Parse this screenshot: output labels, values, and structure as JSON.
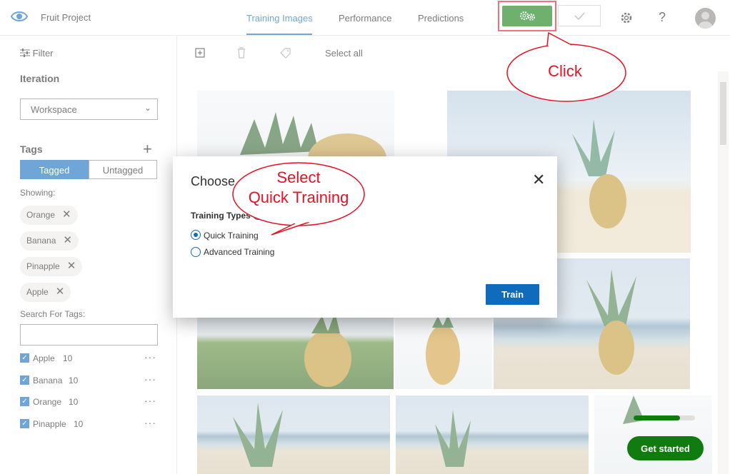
{
  "header": {
    "project_title": "Fruit Project",
    "tabs": [
      {
        "label": "Training Images",
        "active": true
      },
      {
        "label": "Performance",
        "active": false
      },
      {
        "label": "Predictions",
        "active": false
      }
    ],
    "help_label": "?",
    "train_icon": "gears-icon",
    "quick_test_icon": "check-icon"
  },
  "sidebar": {
    "filter_label": "Filter",
    "iteration_heading": "Iteration",
    "iteration_value": "Workspace",
    "tags_heading": "Tags",
    "toggle": {
      "tagged": "Tagged",
      "untagged": "Untagged"
    },
    "showing_label": "Showing:",
    "chips": [
      "Orange",
      "Banana",
      "Pinapple",
      "Apple"
    ],
    "search_label": "Search For Tags:",
    "tag_list": [
      {
        "name": "Apple",
        "count": "10"
      },
      {
        "name": "Banana",
        "count": "10"
      },
      {
        "name": "Orange",
        "count": "10"
      },
      {
        "name": "Pinapple",
        "count": "10"
      }
    ]
  },
  "main": {
    "select_all": "Select all"
  },
  "dialog": {
    "title": "Choose",
    "training_types_label": "Training Types",
    "options": [
      {
        "label": "Quick Training",
        "selected": true
      },
      {
        "label": "Advanced Training",
        "selected": false
      }
    ],
    "train_button": "Train",
    "close_label": "✕"
  },
  "callouts": {
    "click": "Click",
    "select_line1": "Select",
    "select_line2": "Quick Training"
  },
  "get_started": {
    "label": "Get started",
    "progress_percent": 75
  },
  "colors": {
    "accent": "#0f6cbd",
    "train_green": "#107c10",
    "callout_red": "#e81123"
  }
}
